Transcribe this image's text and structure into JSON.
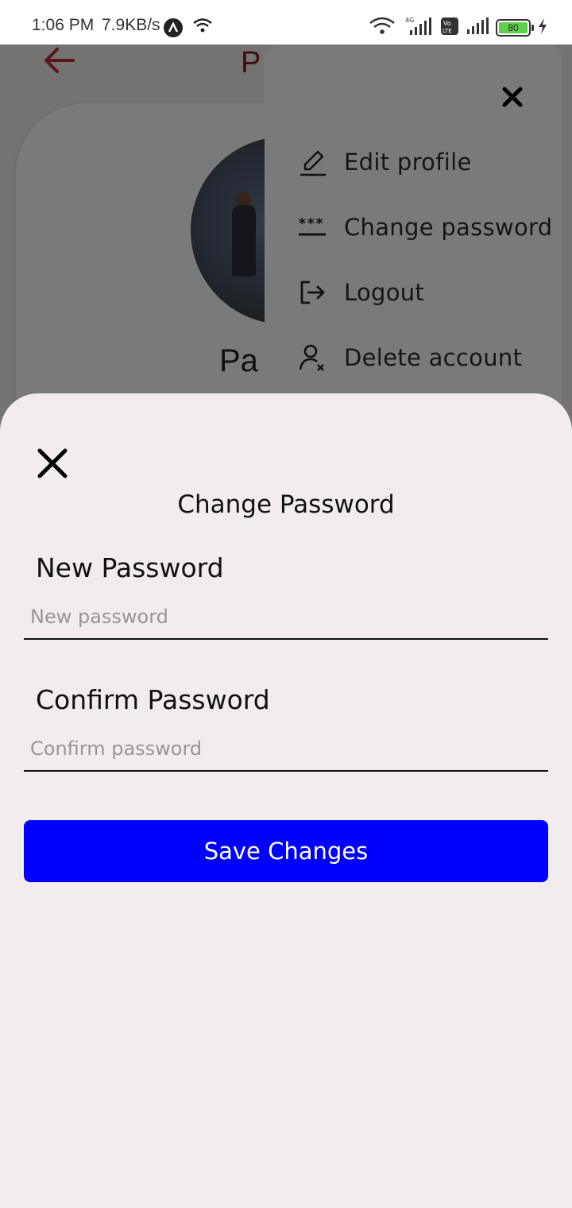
{
  "status_bar": {
    "time": "1:06 PM",
    "net_speed": "7.9KB/s",
    "battery_level": "80",
    "icons": [
      "arc-app-icon",
      "wifi-icon",
      "wifi-icon",
      "signal-4g-icon",
      "volte-icon",
      "signal-icon",
      "battery-icon",
      "charging-icon"
    ]
  },
  "background_page": {
    "title_peek": "P",
    "name_peek": "Pa"
  },
  "options_menu": {
    "items": [
      {
        "label": "Edit profile",
        "icon": "edit-pencil-icon"
      },
      {
        "label": "Change password",
        "icon": "password-dots-icon"
      },
      {
        "label": "Logout",
        "icon": "logout-icon"
      },
      {
        "label": "Delete account",
        "icon": "delete-user-icon"
      }
    ]
  },
  "change_password_sheet": {
    "title": "Change Password",
    "new_password": {
      "label": "New Password",
      "placeholder": "New password",
      "value": ""
    },
    "confirm_password": {
      "label": "Confirm Password",
      "placeholder": "Confirm password",
      "value": ""
    },
    "save_label": "Save Changes"
  },
  "colors": {
    "accent_button": "#0000ff",
    "sheet_background": "#f3eced",
    "title_red": "#7a1f1f"
  }
}
